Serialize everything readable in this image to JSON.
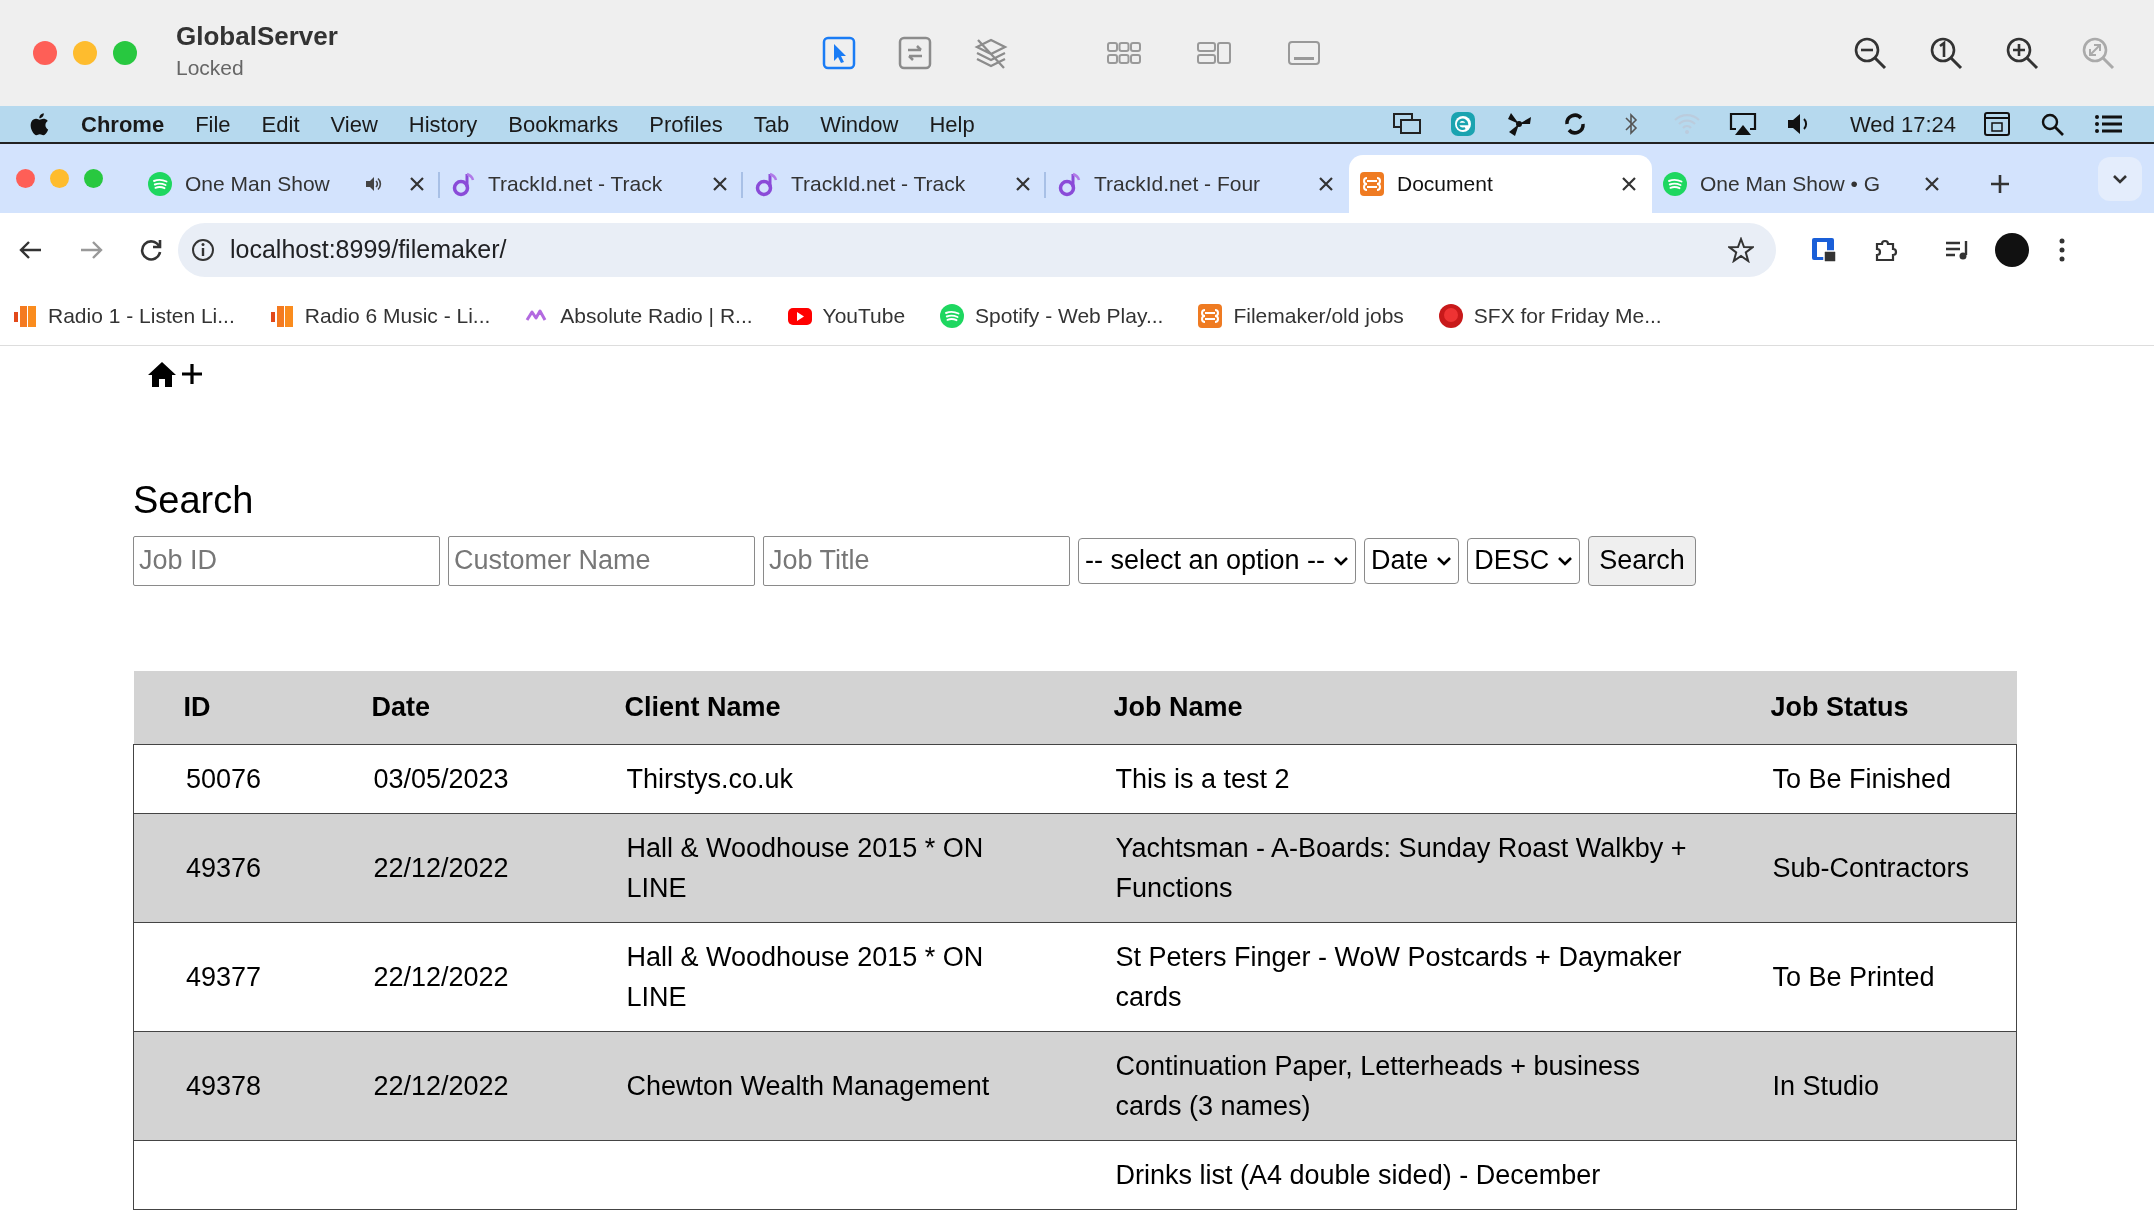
{
  "window": {
    "title": "GlobalServer",
    "subtitle": "Locked"
  },
  "tools": [
    {
      "kind": "pointer",
      "selected": true
    },
    {
      "kind": "swap",
      "selected": false
    },
    {
      "kind": "layers",
      "selected": false
    }
  ],
  "menu_bar": {
    "app": "Chrome",
    "items": [
      "File",
      "Edit",
      "View",
      "History",
      "Bookmarks",
      "Profiles",
      "Tab",
      "Window",
      "Help"
    ],
    "clock": "Wed 17:24"
  },
  "tabs": [
    {
      "title": "One Man Show",
      "kind": "green-circle",
      "audio": true,
      "selected": false
    },
    {
      "title": "TrackId.net - Track",
      "kind": "note",
      "audio": false,
      "selected": false
    },
    {
      "title": "TrackId.net - Track",
      "kind": "note",
      "audio": false,
      "selected": false
    },
    {
      "title": "TrackId.net - Four",
      "kind": "note",
      "audio": false,
      "selected": false
    },
    {
      "title": "Document",
      "kind": "orange-square",
      "audio": false,
      "selected": true
    },
    {
      "title": "One Man Show • G",
      "kind": "green-circle",
      "audio": false,
      "selected": false
    }
  ],
  "address": "localhost:8999/filemaker/",
  "bookmarks": [
    {
      "title": "Radio 1 - Listen Li...",
      "kind": "bars"
    },
    {
      "title": "Radio 6 Music - Li...",
      "kind": "bars"
    },
    {
      "title": "Absolute Radio | R...",
      "kind": "wave"
    },
    {
      "title": "YouTube",
      "kind": "play"
    },
    {
      "title": "Spotify - Web Play...",
      "kind": "green-circle"
    },
    {
      "title": "Filemaker/old jobs",
      "kind": "orange-square"
    },
    {
      "title": "SFX for Friday Me...",
      "kind": "red-dot"
    }
  ],
  "search": {
    "heading": "Search",
    "fields": [
      {
        "placeholder": "Job ID"
      },
      {
        "placeholder": "Customer Name"
      },
      {
        "placeholder": "Job Title"
      }
    ],
    "selects": [
      "-- select an option --",
      "Date",
      "DESC"
    ],
    "button": "Search"
  },
  "table": {
    "columns": [
      "ID",
      "Date",
      "Client Name",
      "Job Name",
      "Job Status"
    ],
    "rows": [
      {
        "id": "50076",
        "date": "03/05/2023",
        "client": "Thirstys.co.uk",
        "job": "This is a test 2",
        "status": "To Be Finished"
      },
      {
        "id": "49376",
        "date": "22/12/2022",
        "client": "Hall & Woodhouse 2015 * ON LINE",
        "job": "Yachtsman - A-Boards: Sunday Roast Walkby + Functions",
        "status": "Sub-Contractors"
      },
      {
        "id": "49377",
        "date": "22/12/2022",
        "client": "Hall & Woodhouse 2015 * ON LINE",
        "job": "St Peters Finger - WoW Postcards + Daymaker cards",
        "status": "To Be Printed"
      },
      {
        "id": "49378",
        "date": "22/12/2022",
        "client": "Chewton Wealth Management",
        "job": "Continuation Paper, Letterheads + business cards (3 names)",
        "status": "In Studio"
      },
      {
        "job": "Drinks list (A4 double sided) - December"
      }
    ]
  }
}
